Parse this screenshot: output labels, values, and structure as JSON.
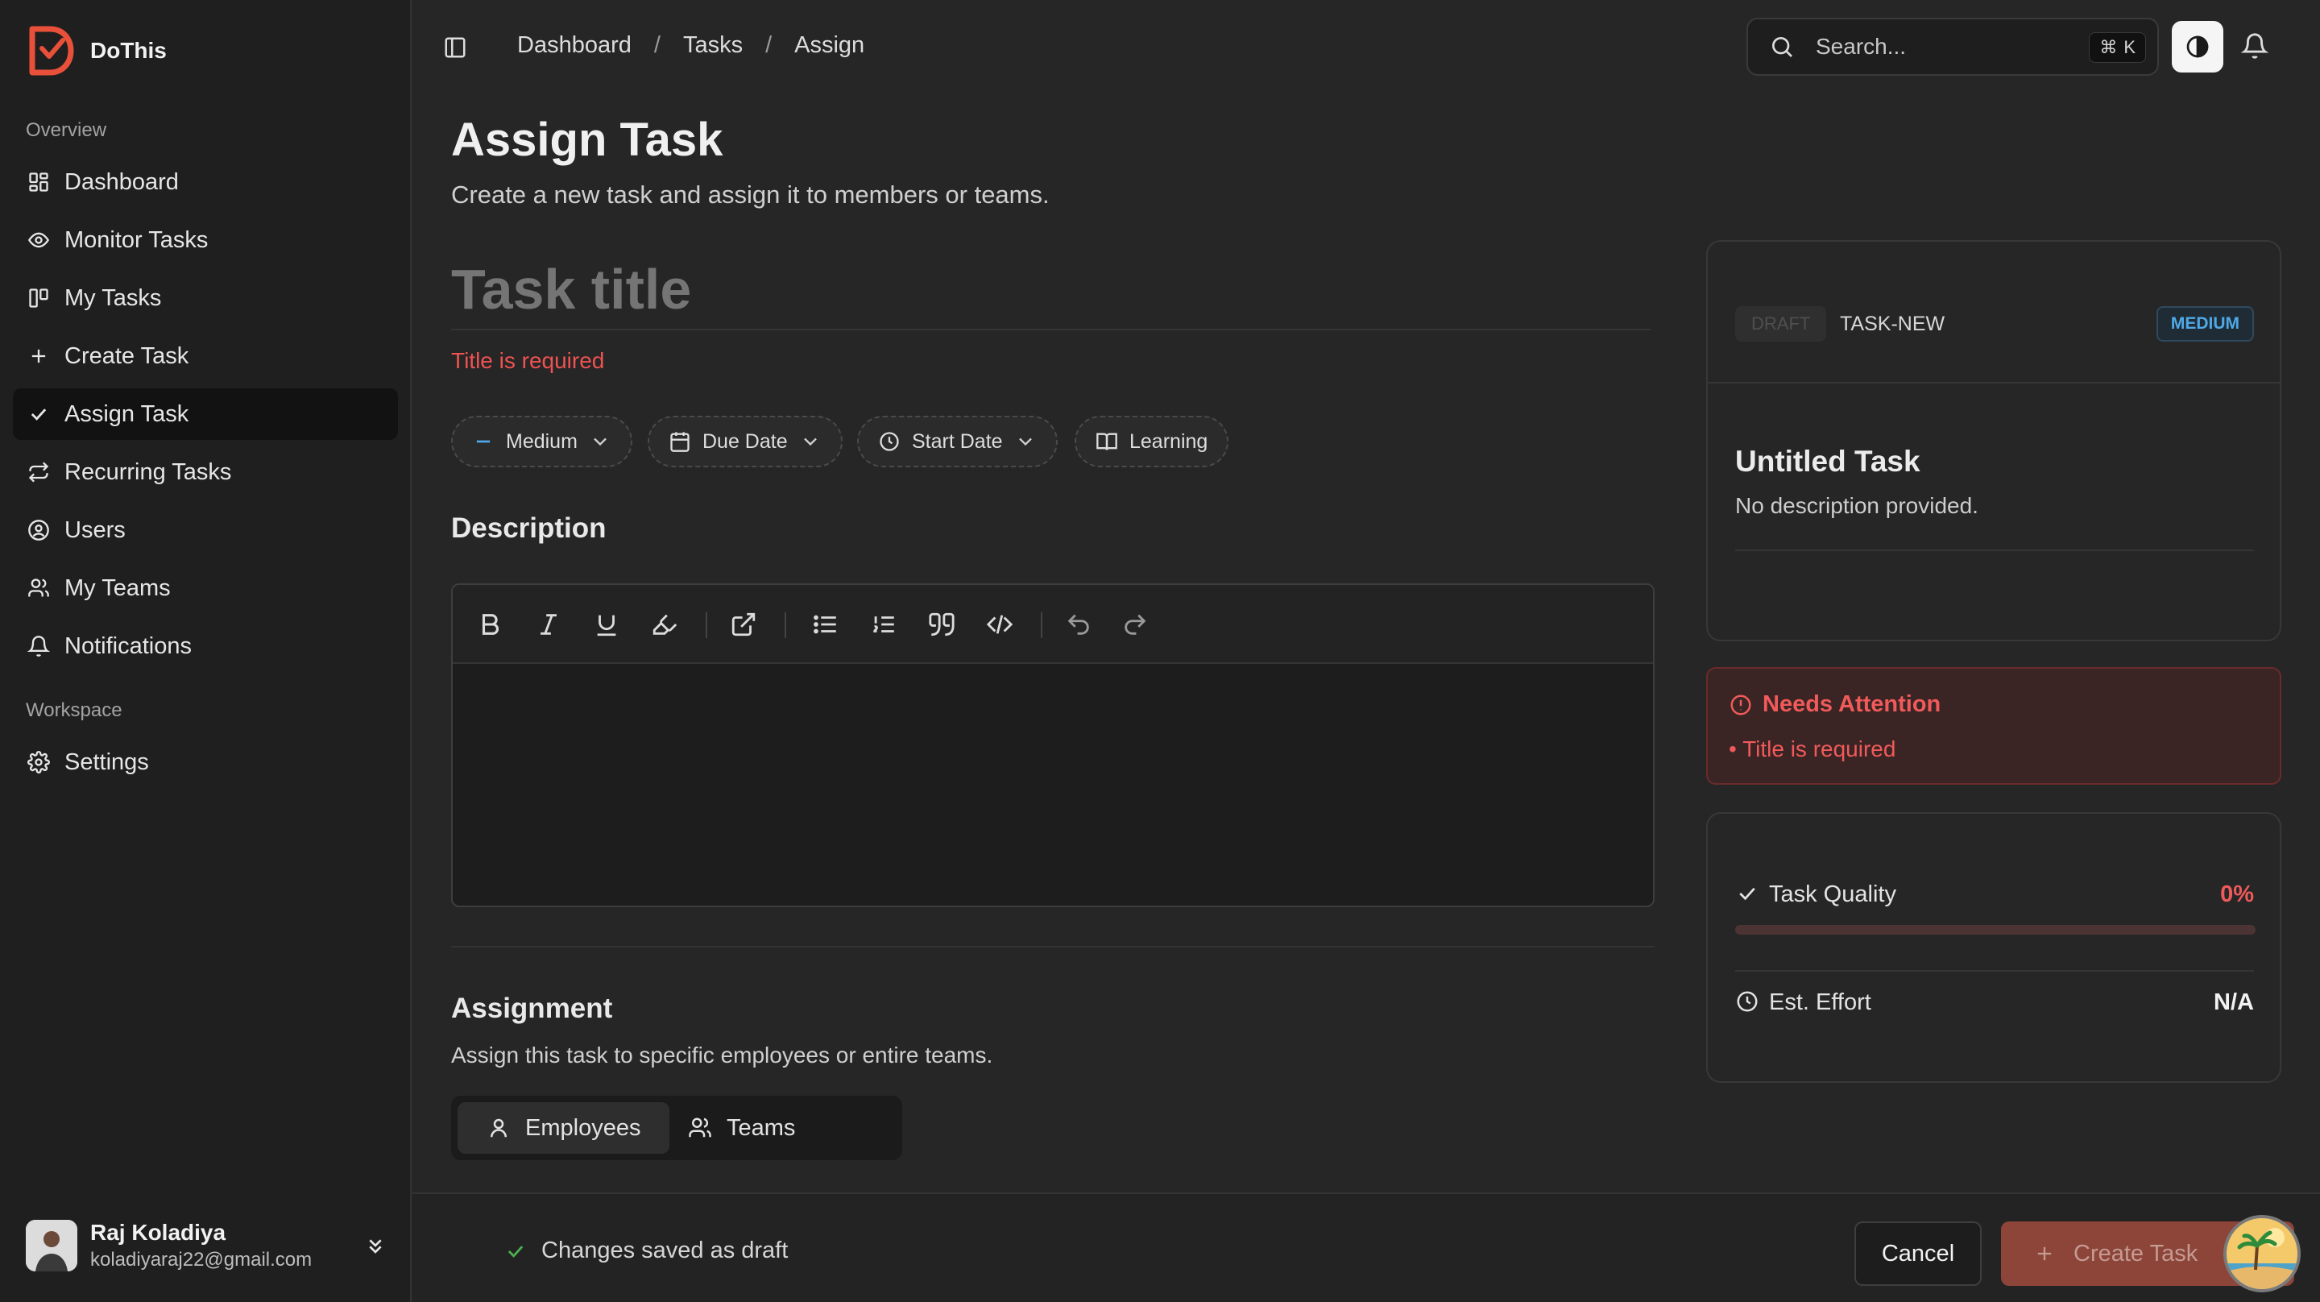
{
  "app": {
    "name": "DoThis",
    "accent": "#e8503a"
  },
  "sidebar": {
    "section_overview": "Overview",
    "section_workspace": "Workspace",
    "items": [
      {
        "label": "Dashboard",
        "icon": "grid-icon"
      },
      {
        "label": "Monitor Tasks",
        "icon": "eye-icon"
      },
      {
        "label": "My Tasks",
        "icon": "kanban-icon"
      },
      {
        "label": "Create Task",
        "icon": "plus-icon"
      },
      {
        "label": "Assign Task",
        "icon": "check-icon",
        "active": true
      },
      {
        "label": "Recurring Tasks",
        "icon": "repeat-icon"
      },
      {
        "label": "Users",
        "icon": "user-circle-icon"
      },
      {
        "label": "My Teams",
        "icon": "users-icon"
      },
      {
        "label": "Notifications",
        "icon": "bell-icon"
      }
    ],
    "workspace_items": [
      {
        "label": "Settings",
        "icon": "gear-icon"
      }
    ],
    "user": {
      "name": "Raj Koladiya",
      "email": "koladiyaraj22@gmail.com"
    }
  },
  "topbar": {
    "breadcrumb": [
      "Dashboard",
      "Tasks",
      "Assign"
    ],
    "breadcrumb_sep": "/",
    "search_placeholder": "Search...",
    "shortcut_key": "K"
  },
  "page": {
    "title": "Assign Task",
    "subtitle": "Create a new task and assign it to members or teams.",
    "title_placeholder": "Task title",
    "title_error": "Title is required",
    "chips": {
      "priority": "Medium",
      "due": "Due Date",
      "start": "Start Date",
      "category": "Learning"
    },
    "description_heading": "Description",
    "assignment_heading": "Assignment",
    "assignment_sub": "Assign this task to specific employees or entire teams.",
    "assign_tabs": [
      "Employees",
      "Teams"
    ]
  },
  "preview": {
    "status": "DRAFT",
    "task_id": "TASK-NEW",
    "priority": "MEDIUM",
    "title": "Untitled Task",
    "description": "No description provided."
  },
  "attention": {
    "title": "Needs Attention",
    "items": [
      "• Title is required"
    ]
  },
  "quality": {
    "label": "Task Quality",
    "value": "0%",
    "progress": 0,
    "effort_label": "Est. Effort",
    "effort_value": "N/A"
  },
  "footer": {
    "saved": "Changes saved as draft",
    "cancel": "Cancel",
    "create": "Create Task"
  }
}
